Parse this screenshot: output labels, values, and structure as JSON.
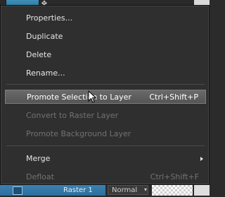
{
  "background": {
    "layer_name": "Raster 1",
    "blend_mode": "Normal"
  },
  "menu": {
    "items": [
      {
        "label": "Properties...",
        "shortcut": "",
        "enabled": true
      },
      {
        "label": "Duplicate",
        "shortcut": "",
        "enabled": true
      },
      {
        "label": "Delete",
        "shortcut": "",
        "enabled": true
      },
      {
        "label": "Rename...",
        "shortcut": "",
        "enabled": true
      },
      {
        "label": "Promote Selection to Layer",
        "shortcut": "Ctrl+Shift+P",
        "enabled": true,
        "highlighted": true
      },
      {
        "label": "Convert to Raster Layer",
        "shortcut": "",
        "enabled": false
      },
      {
        "label": "Promote Background Layer",
        "shortcut": "",
        "enabled": false
      },
      {
        "label": "Merge",
        "shortcut": "",
        "enabled": true,
        "submenu": true
      },
      {
        "label": "Defloat",
        "shortcut": "Ctrl+Shift+F",
        "enabled": false
      }
    ]
  },
  "icons": {
    "move": "move-arrows-icon",
    "cursor": "mouse-pointer-icon",
    "submenu": "chevron-right-icon"
  }
}
